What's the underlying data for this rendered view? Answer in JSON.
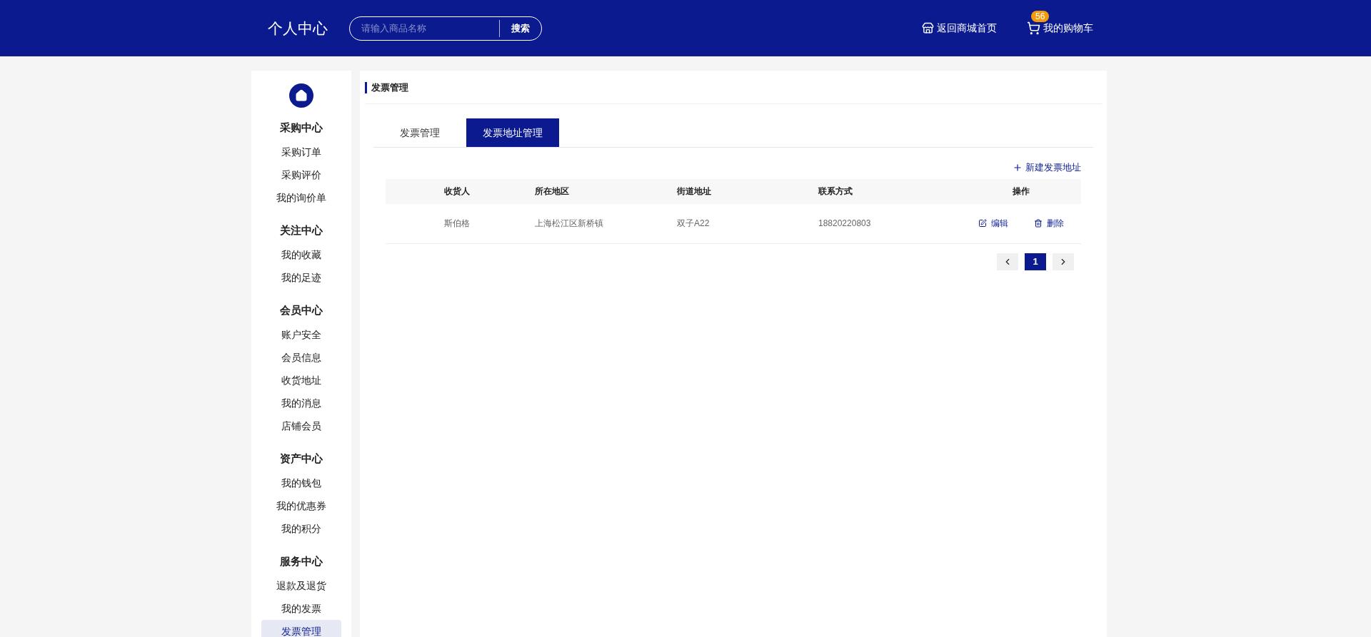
{
  "header": {
    "title": "个人中心",
    "search": {
      "placeholder": "请输入商品名称",
      "button": "搜索"
    },
    "home_link": "返回商城首页",
    "cart": {
      "label": "我的购物车",
      "count": "56"
    }
  },
  "sidebar": {
    "groups": [
      {
        "heading": "采购中心",
        "items": [
          {
            "label": "采购订单",
            "selected": false
          },
          {
            "label": "采购评价",
            "selected": false
          },
          {
            "label": "我的询价单",
            "selected": false
          }
        ]
      },
      {
        "heading": "关注中心",
        "items": [
          {
            "label": "我的收藏",
            "selected": false
          },
          {
            "label": "我的足迹",
            "selected": false
          }
        ]
      },
      {
        "heading": "会员中心",
        "items": [
          {
            "label": "账户安全",
            "selected": false
          },
          {
            "label": "会员信息",
            "selected": false
          },
          {
            "label": "收货地址",
            "selected": false
          },
          {
            "label": "我的消息",
            "selected": false
          },
          {
            "label": "店铺会员",
            "selected": false
          }
        ]
      },
      {
        "heading": "资产中心",
        "items": [
          {
            "label": "我的钱包",
            "selected": false
          },
          {
            "label": "我的优惠券",
            "selected": false
          },
          {
            "label": "我的积分",
            "selected": false
          }
        ]
      },
      {
        "heading": "服务中心",
        "items": [
          {
            "label": "退款及退货",
            "selected": false
          },
          {
            "label": "我的发票",
            "selected": false
          },
          {
            "label": "发票管理",
            "selected": true
          }
        ]
      }
    ]
  },
  "main": {
    "title": "发票管理",
    "tabs": [
      {
        "label": "发票管理",
        "selected": false
      },
      {
        "label": "发票地址管理",
        "selected": true
      }
    ],
    "new_button": "新建发票地址",
    "table": {
      "columns": [
        "收货人",
        "所在地区",
        "街道地址",
        "联系方式",
        "操作"
      ],
      "rows": [
        {
          "cells": [
            "斯伯格",
            "上海松江区新桥镇",
            "双子A22",
            "18820220803"
          ],
          "edit": "编辑",
          "delete": "删除"
        }
      ]
    },
    "pagination": {
      "pages": [
        {
          "label": "1",
          "selected": true
        }
      ]
    }
  }
}
